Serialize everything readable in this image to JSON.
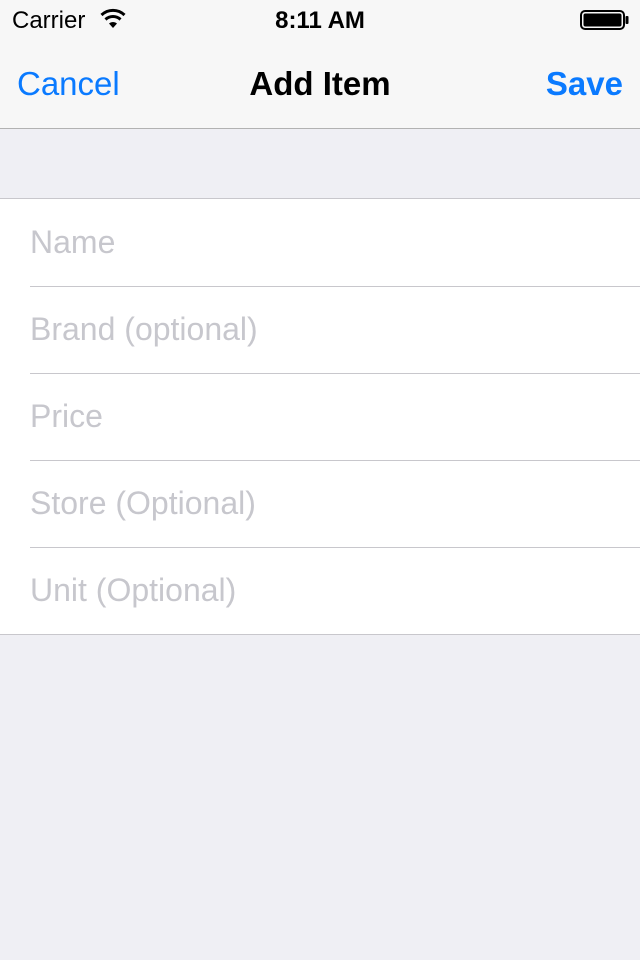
{
  "status_bar": {
    "carrier": "Carrier",
    "time": "8:11 AM",
    "wifi_icon": "wifi-icon",
    "battery_icon": "battery-full-icon"
  },
  "nav_bar": {
    "cancel_label": "Cancel",
    "title": "Add Item",
    "save_label": "Save",
    "accent_color": "#0a7aff"
  },
  "form": {
    "fields": [
      {
        "placeholder": "Name",
        "value": ""
      },
      {
        "placeholder": "Brand (optional)",
        "value": ""
      },
      {
        "placeholder": "Price",
        "value": ""
      },
      {
        "placeholder": "Store (Optional)",
        "value": ""
      },
      {
        "placeholder": "Unit (Optional)",
        "value": ""
      }
    ]
  },
  "colors": {
    "background": "#efeff4",
    "header_background": "#f7f7f7",
    "placeholder": "#c7c7cd",
    "separator": "#c8c7cc"
  }
}
